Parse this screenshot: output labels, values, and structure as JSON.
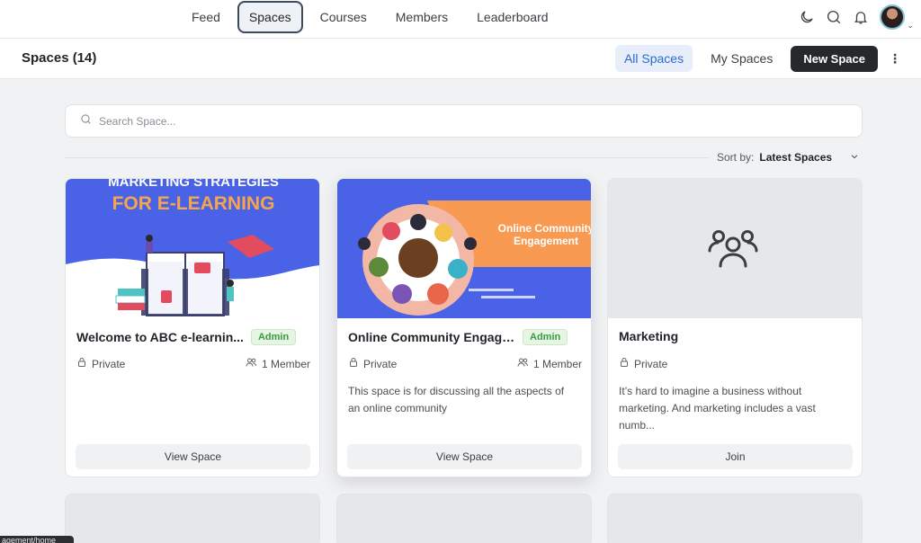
{
  "nav": {
    "tabs": [
      {
        "label": "Feed",
        "active": false
      },
      {
        "label": "Spaces",
        "active": true
      },
      {
        "label": "Courses",
        "active": false
      },
      {
        "label": "Members",
        "active": false
      },
      {
        "label": "Leaderboard",
        "active": false
      }
    ],
    "icons": [
      "moon-icon",
      "search-icon",
      "bell-icon",
      "avatar"
    ]
  },
  "header": {
    "title": "Spaces (14)",
    "filters": [
      {
        "label": "All Spaces",
        "active": true
      },
      {
        "label": "My Spaces",
        "active": false
      }
    ],
    "new_space_label": "New Space",
    "more_icon": "vertical-dots-icon"
  },
  "search": {
    "placeholder": "Search Space..."
  },
  "sort": {
    "label": "Sort by:",
    "value": "Latest Spaces"
  },
  "cards": [
    {
      "image_text": [
        "MARKETING STRATEGIES",
        "FOR E-LEARNING"
      ],
      "title": "Welcome to ABC e-learnin...",
      "badge": "Admin",
      "privacy": "Private",
      "members": "1 Member",
      "description": "",
      "button": "View Space"
    },
    {
      "image_text": [
        "Online Community",
        "Engagement"
      ],
      "title": "Online Community Engagem...",
      "badge": "Admin",
      "privacy": "Private",
      "members": "1 Member",
      "description": "This space is for discussing all the aspects of an online community",
      "button": "View Space"
    },
    {
      "image_text": [],
      "title": "Marketing",
      "badge": "",
      "privacy": "Private",
      "members": "",
      "description": "It’s hard to imagine a business without marketing. And marketing includes a vast numb...",
      "button": "Join"
    }
  ],
  "status_url": "agement/home",
  "colors": {
    "accent": "#2a6bd1",
    "admin_badge": "#3d9a47",
    "dark_button": "#26282c",
    "card1_banner": "#4a63e6",
    "card1_heading": "#f6a54a",
    "card2_banner": "#4a63e6",
    "card2_ribbon": "#f89a52"
  }
}
